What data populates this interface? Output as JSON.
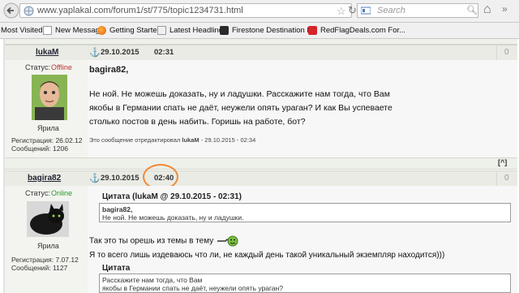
{
  "browser": {
    "url": "www.yaplakal.com/forum1/st/775/topic1234731.html",
    "search_placeholder": "Search",
    "accent": "#f08a36"
  },
  "bookmarks": [
    {
      "label": "Most Visited"
    },
    {
      "label": "New Message"
    },
    {
      "label": "Getting Started"
    },
    {
      "label": "Latest Headlines"
    },
    {
      "label": "Firestone Destination L..."
    },
    {
      "label": "RedFlagDeals.com For..."
    }
  ],
  "posts": [
    {
      "username": "lukaM",
      "status_label": "Статус:",
      "status_value": "Offline",
      "rank": "Ярила",
      "reg_label": "Регистрация:",
      "reg_date": "26.02.12",
      "msgs_label": "Сообщений:",
      "msgs_count": "1206",
      "date": "29.10.2015",
      "time": "02:31",
      "post_number": "0",
      "greeting": "bagira82,",
      "lines": [
        "Не ной. Не можешь доказать, ну и ладушки. Расскажите нам тогда, что Вам",
        "якобы в Германии спать не даёт, неужели опять ураган? И как Вы успеваете",
        "столько постов в день набить. Горишь на работе, бот?"
      ],
      "edited_prefix": "Это сообщение отредактировал",
      "edited_user": "lukaM",
      "edited_suffix": "- 29.10.2015 - 02:34",
      "up_button": "[^]"
    },
    {
      "username": "bagira82",
      "status_label": "Статус:",
      "status_value": "Online",
      "rank": "Ярила",
      "reg_label": "Регистрация:",
      "reg_date": "7.07.12",
      "msgs_label": "Сообщений:",
      "msgs_count": "1127",
      "date": "29.10.2015",
      "time": "02:40",
      "post_number": "0",
      "quote1_header": "Цитата (lukaM @ 29.10.2015 - 02:31)",
      "quote1_name": "bagira82,",
      "quote1_text": "Не ной. Не можешь доказать, ну и ладушки.",
      "text1": "Так это ты орешь из темы в тему",
      "text2": "Я то всего лишь издеваюсь что ли, не каждый день такой уникальный экземпляр находится)))",
      "quote2_header": "Цитата",
      "quote2_lines": [
        "Расскажите нам тогда, что Вам",
        "якобы в Германии спать не даёт, неужели опять ураган?"
      ]
    }
  ]
}
